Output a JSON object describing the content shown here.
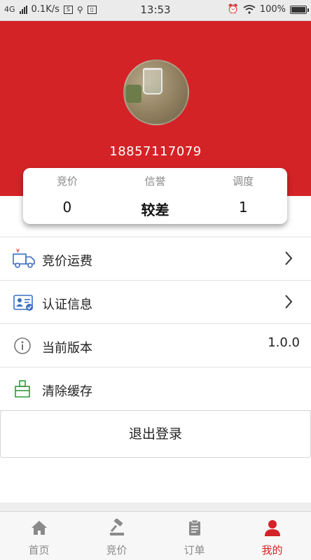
{
  "status_bar": {
    "network": "4G",
    "speed": "0.1K/s",
    "time": "13:53",
    "battery": "100%"
  },
  "profile": {
    "phone": "18857117079"
  },
  "stats": [
    {
      "label": "竞价",
      "value": "0"
    },
    {
      "label": "信誉",
      "value": "较差"
    },
    {
      "label": "调度",
      "value": "1"
    }
  ],
  "menu": {
    "freight": {
      "label": "竞价运费",
      "icon": "truck-icon"
    },
    "certification": {
      "label": "认证信息",
      "icon": "id-card-icon"
    },
    "version": {
      "label": "当前版本",
      "value": "1.0.0",
      "icon": "info-icon"
    },
    "clear_cache": {
      "label": "清除缓存",
      "icon": "broom-icon"
    }
  },
  "logout_label": "退出登录",
  "tabs": [
    {
      "label": "首页",
      "icon": "home-icon"
    },
    {
      "label": "竞价",
      "icon": "gavel-icon"
    },
    {
      "label": "订单",
      "icon": "clipboard-icon"
    },
    {
      "label": "我的",
      "icon": "user-icon"
    }
  ],
  "colors": {
    "brand_red": "#d42327",
    "icon_blue": "#3b6fc4",
    "icon_green": "#2e9a3b"
  }
}
